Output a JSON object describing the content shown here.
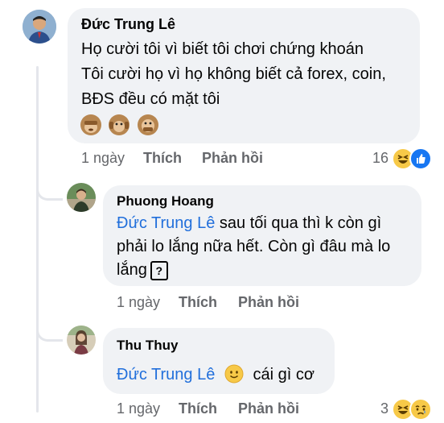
{
  "comments": [
    {
      "author": "Đức Trung Lê",
      "lines": [
        "Họ cười tôi vì biết tôi chơi chứng khoán",
        "Tôi cười họ vì họ không biết cả forex, coin,",
        "BĐS đều có mặt tôi"
      ],
      "emoji_icons": [
        "see-no-evil-monkey-icon",
        "hear-no-evil-monkey-icon",
        "speak-no-evil-monkey-icon"
      ],
      "time": "1 ngày",
      "like": "Thích",
      "reply": "Phản hồi",
      "reaction_count": "16",
      "reaction_icons": [
        "haha-icon",
        "like-icon"
      ]
    },
    {
      "author": "Phuong Hoang",
      "mention": "Đức Trung Lê",
      "line1_rest": " sau tối qua thì k còn gì",
      "line2": "phải lo lắng nữa hết. Còn gì đâu mà lo",
      "line3": "lắng",
      "unknown_glyph": "?",
      "time": "1 ngày",
      "like": "Thích",
      "reply": "Phản hồi"
    },
    {
      "author": "Thu Thuy",
      "mention": "Đức Trung Lê",
      "emoji_icon": "slightly-smiling-face-icon",
      "rest": "cái gì cơ",
      "time": "1 ngày",
      "like": "Thích",
      "reply": "Phản hồi",
      "reaction_count": "3",
      "reaction_icons": [
        "haha-icon",
        "sad-icon"
      ]
    }
  ],
  "colors": {
    "bubble": "#f0f2f5",
    "mention": "#216fdb",
    "meta": "#65676b",
    "like": "#1877f2"
  }
}
